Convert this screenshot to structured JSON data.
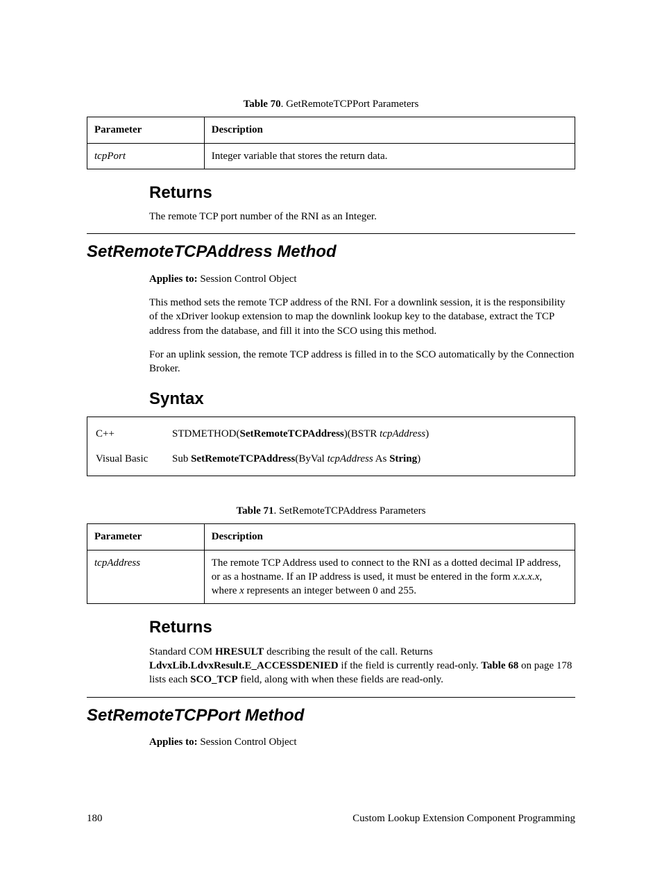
{
  "table70": {
    "caption_label": "Table 70",
    "caption_text": ". GetRemoteTCPPort Parameters",
    "header_param": "Parameter",
    "header_desc": "Description",
    "row_param": "tcpPort",
    "row_desc": "Integer variable that stores the return data."
  },
  "returns1": {
    "heading": "Returns",
    "text": "The remote TCP port number of the RNI as an Integer."
  },
  "method1": {
    "heading": "SetRemoteTCPAddress Method",
    "applies_label": "Applies to:",
    "applies_value": "  Session Control Object",
    "para1": "This method sets the remote TCP address of the RNI.  For a downlink session, it is the responsibility of the xDriver lookup extension to map the downlink lookup key to the database, extract the TCP address from the database, and fill it into the SCO using this method.",
    "para2": "For an uplink session, the remote TCP address is filled in to the SCO automatically by the Connection Broker."
  },
  "syntax": {
    "heading": "Syntax",
    "cpp_label": "C++",
    "cpp_pre": "STDMETHOD(",
    "cpp_method": "SetRemoteTCPAddress",
    "cpp_mid": ")(BSTR ",
    "cpp_arg": "tcpAddress",
    "cpp_post": ")",
    "vb_label": "Visual Basic",
    "vb_pre1": "Sub ",
    "vb_method": "SetRemoteTCPAddress",
    "vb_mid1": "(ByVal ",
    "vb_arg": "tcpAddress",
    "vb_mid2": " As ",
    "vb_type": "String",
    "vb_post": ")"
  },
  "table71": {
    "caption_label": "Table 71",
    "caption_text": ". SetRemoteTCPAddress Parameters",
    "header_param": "Parameter",
    "header_desc": "Description",
    "row_param": "tcpAddress",
    "row_desc_a": "The remote TCP Address used to connect to the RNI as a dotted decimal IP address, or as a hostname.  If an IP address is used, it must be entered in the form ",
    "row_desc_b": "x.x.x.x",
    "row_desc_c": ", where ",
    "row_desc_d": "x",
    "row_desc_e": " represents an integer between 0 and 255."
  },
  "returns2": {
    "heading": "Returns",
    "text_a": "Standard COM ",
    "text_b": "HRESULT",
    "text_c": " describing the result of the call.  Returns ",
    "text_d": "LdvxLib.LdvxResult.E_ACCESSDENIED",
    "text_e": " if the field is currently read-only.  ",
    "text_f": "Table 68",
    "text_g": " on page 178 lists each ",
    "text_h": "SCO_TCP",
    "text_i": " field, along with when these fields are read-only."
  },
  "method2": {
    "heading": "SetRemoteTCPPort Method",
    "applies_label": "Applies to:",
    "applies_value": "  Session Control Object"
  },
  "footer": {
    "page": "180",
    "title": "Custom Lookup Extension Component Programming"
  }
}
